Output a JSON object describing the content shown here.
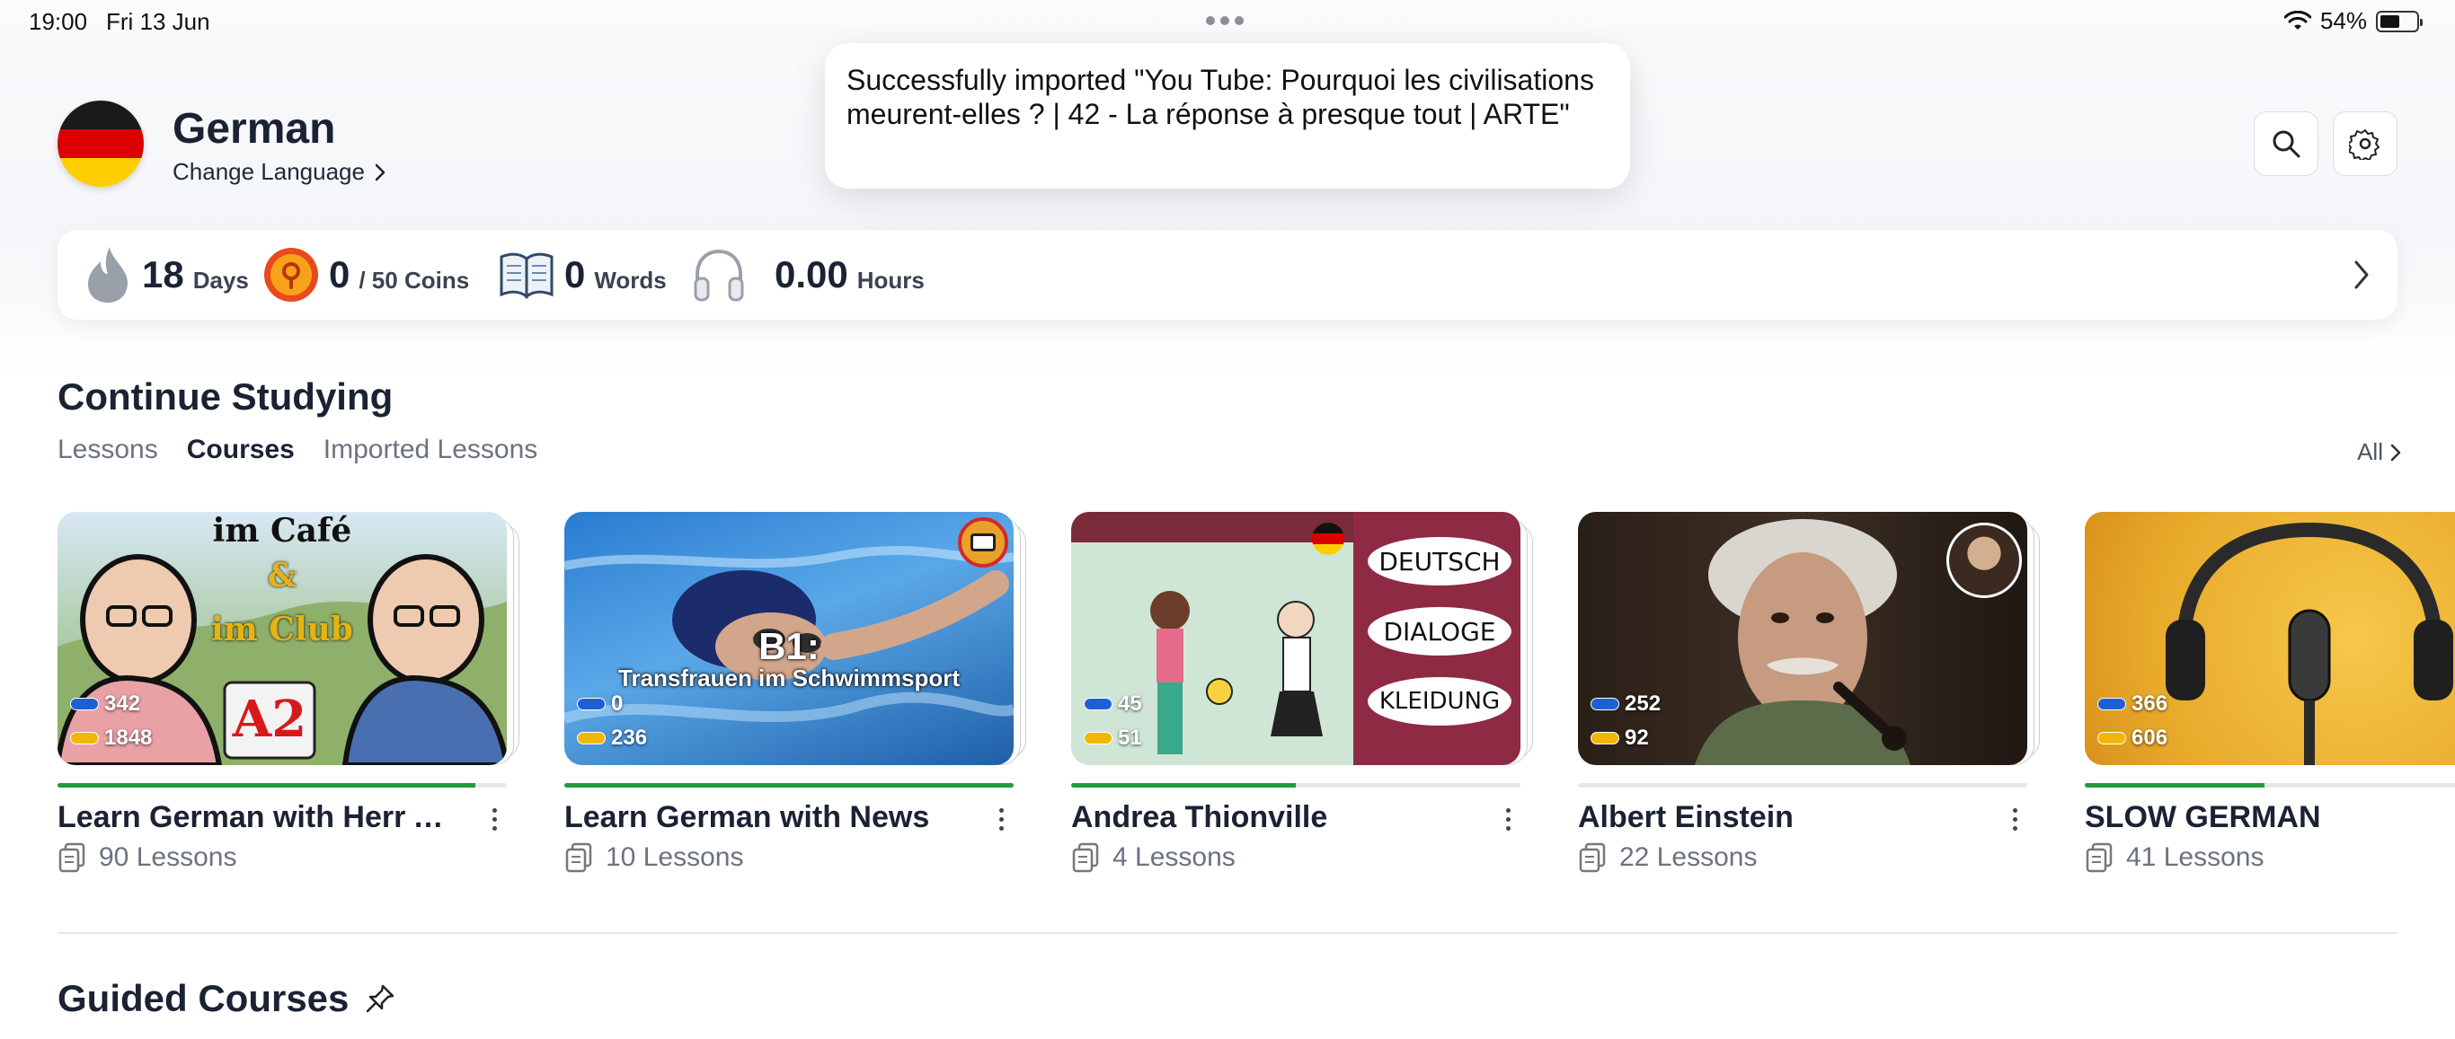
{
  "status_bar": {
    "time": "19:00",
    "date": "Fri 13 Jun",
    "battery": "54%",
    "battery_level": 0.54
  },
  "toast": {
    "message": "Successfully imported \"You Tube: Pourquoi les civilisations meurent-elles ? | 42 - La réponse à presque tout | ARTE\""
  },
  "header": {
    "language": "German",
    "change_language": "Change Language",
    "flag_colors": [
      "#1a1a1a",
      "#dd0000",
      "#ffce00"
    ]
  },
  "stats": {
    "streak_value": "18",
    "streak_unit": "Days",
    "coins_value": "0",
    "coins_unit": "/ 50 Coins",
    "words_value": "0",
    "words_unit": "Words",
    "hours_value": "0.00",
    "hours_unit": "Hours"
  },
  "continue": {
    "title": "Continue Studying",
    "tabs": [
      "Lessons",
      "Courses",
      "Imported Lessons"
    ],
    "active_tab": "Courses",
    "all_label": "All"
  },
  "courses": [
    {
      "title": "Learn German with Herr A...",
      "lessons": "90 Lessons",
      "blue_count": "342",
      "yellow_count": "1848",
      "progress": 0.93,
      "thumb_text_1": "im Café",
      "thumb_text_2": "&",
      "thumb_text_3": "im Club",
      "thumb_badge": "A2"
    },
    {
      "title": "Learn German with News",
      "lessons": "10 Lessons",
      "blue_count": "0",
      "yellow_count": "236",
      "progress": 1.0,
      "thumb_text_1": "B1:",
      "thumb_text_2": "Transfrauen im Schwimmsport"
    },
    {
      "title": "Andrea Thionville",
      "lessons": "4 Lessons",
      "blue_count": "45",
      "yellow_count": "51",
      "progress": 0.5,
      "thumb_text_1": "DEUTSCH",
      "thumb_text_2": "DIALOGE",
      "thumb_text_3": "KLEIDUNG"
    },
    {
      "title": "Albert Einstein",
      "lessons": "22 Lessons",
      "blue_count": "252",
      "yellow_count": "92",
      "progress": 0.0
    },
    {
      "title": "SLOW GERMAN",
      "lessons": "41 Lessons",
      "blue_count": "366",
      "yellow_count": "606",
      "progress": 0.4
    }
  ],
  "guided": {
    "title": "Guided Courses"
  }
}
